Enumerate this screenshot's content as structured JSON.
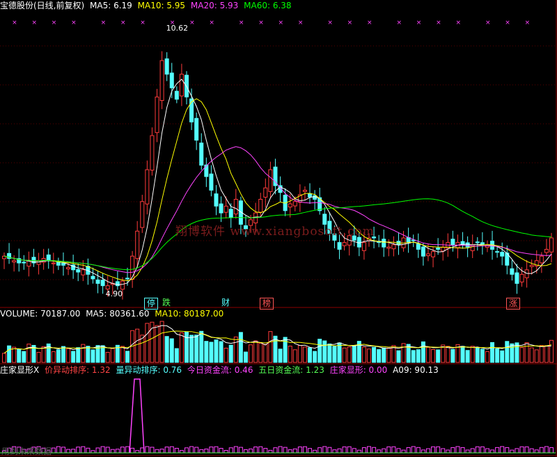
{
  "header": {
    "stock": "宝德股份(日线,前复权)",
    "ma": [
      {
        "label": "MA5: 6.19",
        "color": "#ffffff"
      },
      {
        "label": "MA10: 5.95",
        "color": "#ffff00"
      },
      {
        "label": "MA20: 5.93",
        "color": "#ff44ff"
      },
      {
        "label": "MA60: 6.38",
        "color": "#00ff00"
      }
    ]
  },
  "price_annotations": {
    "high": "10.62",
    "low": "4.90"
  },
  "watermark": "翔博软件 www.xiangbosoft.com",
  "markers": [
    {
      "text": "停",
      "color": "#55ffff"
    },
    {
      "text": "跌",
      "color": "#55ff55"
    },
    {
      "text": "财",
      "color": "#55ffff"
    },
    {
      "text": "榜",
      "color": "#ff5555"
    },
    {
      "text": "涨",
      "color": "#ff5555"
    }
  ],
  "volume_header": [
    {
      "label": "VOLUME: 70187.00",
      "color": "#ffffff"
    },
    {
      "label": "MA5: 80361.60",
      "color": "#ffffff"
    },
    {
      "label": "MA10: 80187.00",
      "color": "#ffff00"
    }
  ],
  "indicator_header": [
    {
      "label": "庄家显形X",
      "color": "#ffffff"
    },
    {
      "label": "价异动排序: 1.32",
      "color": "#ff4444"
    },
    {
      "label": "量异动排序: 0.76",
      "color": "#55ffff"
    },
    {
      "label": "今日资金流: 0.46",
      "color": "#ff44ff"
    },
    {
      "label": "五日资金流: 1.23",
      "color": "#55ff55"
    },
    {
      "label": "庄家显形: 0.00",
      "color": "#ff44ff"
    },
    {
      "label": "A09: 90.13",
      "color": "#ffffff"
    }
  ],
  "footer": "用到未来数据",
  "chart_data": {
    "type": "candlestick",
    "y_range": [
      4.9,
      10.62
    ],
    "closes": [
      5.6,
      5.55,
      5.5,
      5.45,
      5.45,
      5.5,
      5.45,
      5.5,
      5.55,
      5.5,
      5.45,
      5.4,
      5.4,
      5.35,
      5.3,
      5.25,
      5.3,
      5.2,
      5.1,
      5.0,
      4.95,
      4.95,
      5.0,
      4.95,
      5.05,
      5.1,
      5.6,
      6.15,
      6.8,
      7.5,
      8.25,
      9.1,
      9.9,
      9.6,
      9.3,
      9.05,
      9.6,
      9.1,
      8.55,
      8.15,
      7.6,
      7.35,
      7.05,
      6.7,
      6.55,
      6.7,
      6.45,
      6.85,
      6.3,
      6.2,
      6.4,
      6.55,
      6.85,
      7.1,
      7.5,
      7.15,
      7.0,
      6.6,
      6.75,
      6.8,
      6.95,
      7.05,
      6.9,
      6.85,
      6.6,
      6.3,
      6.1,
      5.95,
      5.75,
      5.9,
      6.05,
      5.95,
      5.8,
      5.9,
      6.0,
      6.0,
      5.9,
      5.8,
      5.8,
      5.85,
      5.85,
      6.0,
      5.9,
      5.95,
      5.75,
      5.6,
      5.65,
      5.7,
      5.75,
      5.8,
      5.9,
      5.85,
      5.9,
      5.85,
      5.8,
      5.85,
      5.9,
      5.85,
      5.85,
      5.75,
      5.7,
      5.6,
      5.4,
      5.2,
      5.0,
      5.2,
      5.3,
      5.4,
      5.5,
      5.6,
      5.75,
      6.0
    ],
    "ma_values": {
      "MA5": 6.19,
      "MA10": 5.95,
      "MA20": 5.93,
      "MA60": 6.38
    },
    "volume": {
      "last": 70187.0,
      "MA5": 80361.6,
      "MA10": 80187.0
    },
    "indicator": {
      "价异动排序": 1.32,
      "量异动排序": 0.76,
      "今日资金流": 0.46,
      "五日资金流": 1.23,
      "庄家显形": 0.0,
      "A09": 90.13
    }
  }
}
